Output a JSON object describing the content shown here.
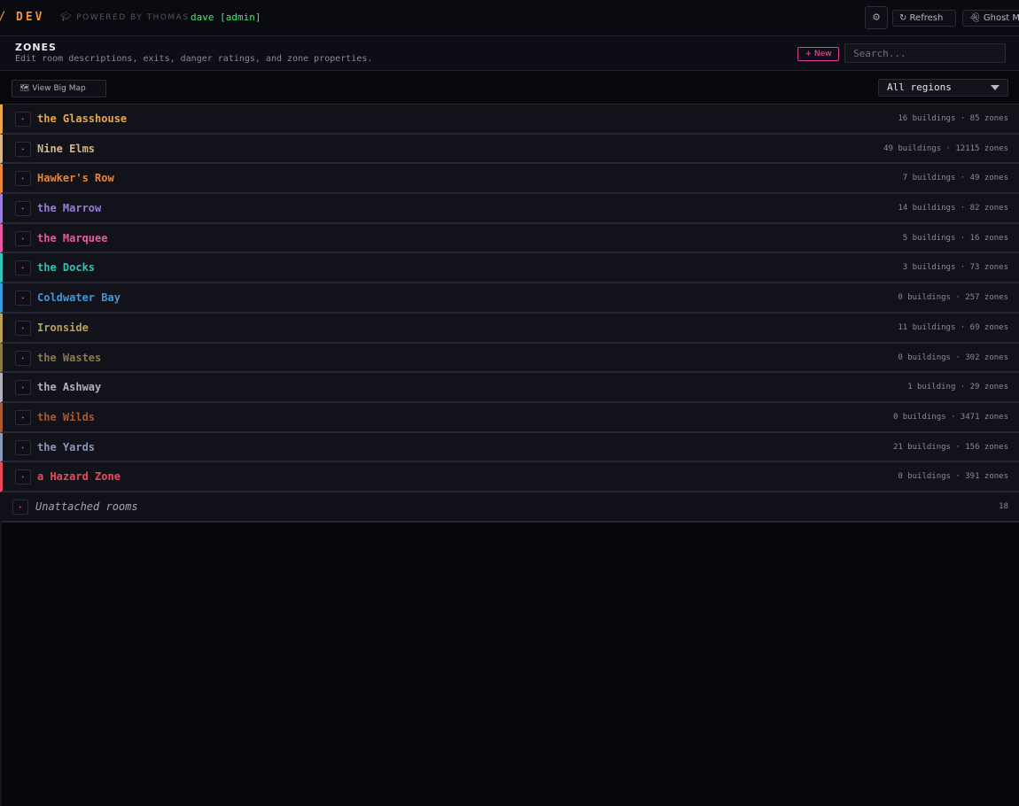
{
  "topbar": {
    "brand": "DEV",
    "brand_mark": "/",
    "powered_by": "POWERED BY THOMAS",
    "powered_icon": "graduation-cap-icon",
    "user": "dave [admin]",
    "gear_icon": "⚙",
    "refresh_label": "↻ Refresh",
    "ghost_label": "Ghost M"
  },
  "header": {
    "title": "ZONES",
    "subtitle": "Edit room descriptions, exits, danger ratings, and zone properties.",
    "new_label": "+ New",
    "search_placeholder": "Search..."
  },
  "toolbar": {
    "map_label": "🗺 View Big Map",
    "region_filter": "All regions"
  },
  "regions": [
    {
      "name": "the Glasshouse",
      "meta": "16 buildings · 85 zones",
      "color": "#e8a84a"
    },
    {
      "name": "Nine Elms",
      "meta": "49 buildings · 12115 zones",
      "color": "#d8b48a"
    },
    {
      "name": "Hawker's Row",
      "meta": "7 buildings · 49 zones",
      "color": "#e8863a"
    },
    {
      "name": "the Marrow",
      "meta": "14 buildings · 82 zones",
      "color": "#9a7ed8"
    },
    {
      "name": "the Marquee",
      "meta": "5 buildings · 16 zones",
      "color": "#e85aa0"
    },
    {
      "name": "the Docks",
      "meta": "3 buildings · 73 zones",
      "color": "#2ec4b8"
    },
    {
      "name": "Coldwater Bay",
      "meta": "0 buildings · 257 zones",
      "color": "#3a9ae0"
    },
    {
      "name": "Ironside",
      "meta": "11 buildings · 69 zones",
      "color": "#b8a05a"
    },
    {
      "name": "the Wastes",
      "meta": "0 buildings · 302 zones",
      "color": "#8a7a4a"
    },
    {
      "name": "the Ashway",
      "meta": "1 building · 29 zones",
      "color": "#b0b0bc"
    },
    {
      "name": "the Wilds",
      "meta": "0 buildings · 3471 zones",
      "color": "#a85a30"
    },
    {
      "name": "the Yards",
      "meta": "21 buildings · 156 zones",
      "color": "#8898b8"
    },
    {
      "name": "a Hazard Zone",
      "meta": "0 buildings · 391 zones",
      "color": "#e84a5a"
    }
  ],
  "unattached": {
    "label": "Unattached rooms",
    "count": "18"
  },
  "row_toggle_icon": "▸"
}
